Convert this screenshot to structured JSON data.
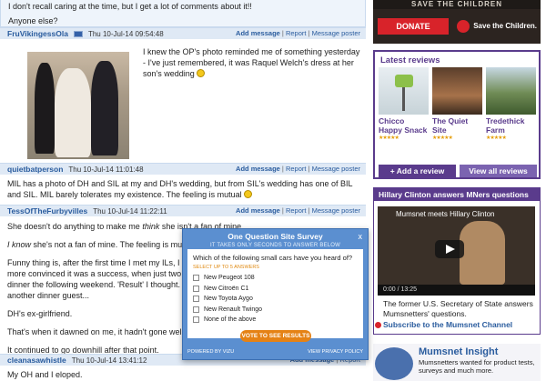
{
  "thread": {
    "top_post": {
      "line1": "I don't recall caring at the time, but I get a lot of comments about it!!",
      "line2": "Anyone else?"
    },
    "posts": [
      {
        "poster": "FruVikingessOla",
        "timestamp": "Thu 10-Jul-14 09:54:48",
        "text": "I knew the OP's photo reminded me of something yesterday - I've just remembered, it was Raquel Welch's dress at her son's wedding"
      },
      {
        "poster": "quietbatperson",
        "timestamp": "Thu 10-Jul-14 11:01:48",
        "text": "MIL has a photo of DH and SIL at my and DH's wedding, but from SIL's wedding has one of BIL and SIL. MIL barely tolerates my existence. The feeling is mutual"
      },
      {
        "poster": "TessOfTheFurbyvilles",
        "timestamp": "Thu 10-Jul-14 11:22:11",
        "p1_before": "She doesn't do anything to make me ",
        "p1_italic": "think",
        "p1_after": " she isn't a fan of mine.",
        "p2_italic": "I know",
        "p2_after": " she's not a fan of mine. The feeling is mu",
        "p3a": "Funny thing is, after the first time I met my ILs, I",
        "p3b": "more convinced it was a success, when just two",
        "p3c": "dinner the following weekend. 'Result' I thought.",
        "p3d": "another dinner guest...",
        "p4": "DH's ex-girlfriend.",
        "p5": "That's when it dawned on me, it hadn't gone well",
        "p6": "It continued to go downhill after that point."
      },
      {
        "poster": "cleanasawhistle",
        "timestamp": "Thu 10-Jul-14 13:41:12",
        "text": "My OH and I eloped."
      }
    ],
    "actions": {
      "add": "Add message",
      "report": "Report",
      "message": "Message poster",
      "sep": "|"
    }
  },
  "sidebar": {
    "ad": {
      "top_text": "SAVE THE CHILDREN",
      "donate": "DONATE",
      "brand": "Save the Children."
    },
    "reviews": {
      "title": "Latest reviews",
      "items": [
        {
          "title": "Chicco Happy Snack",
          "stars": "★★★★★"
        },
        {
          "title": "The Quiet Site",
          "stars": "★★★★★"
        },
        {
          "title": "Tredethick Farm",
          "stars": "★★★★★"
        }
      ],
      "add_button": "+ Add a review",
      "all_button": "View all reviews"
    },
    "video": {
      "header": "Hillary Clinton answers MNers questions",
      "video_title": "Mumsnet meets Hillary Clinton",
      "time": "0:00 / 13:25",
      "caption": "The former U.S. Secretary of State answers Mumsnetters' questions.",
      "subscribe": "Subscribe to the Mumsnet Channel"
    },
    "insight": {
      "title": "Mumsnet Insight",
      "text": "Mumsnetters wanted for product tests, surveys and much more."
    }
  },
  "survey": {
    "title": "One Question Site Survey",
    "subtitle": "IT TAKES ONLY SECONDS TO ANSWER BELOW",
    "close": "x",
    "question": "Which of the following small cars have you heard of?",
    "hint": "SELECT UP TO 5 ANSWERS",
    "options": [
      "New Peugeot 108",
      "New Citroën C1",
      "New Toyota Aygo",
      "New Renault Twingo",
      "None of the above"
    ],
    "vote": "VOTE TO SEE RESULTS",
    "powered": "POWERED BY VIZU",
    "privacy": "VIEW PRIVACY POLICY"
  },
  "colors": {
    "accent_purple": "#5a3b8c",
    "link_blue": "#2a5c9e",
    "donate_red": "#d8232a",
    "survey_blue": "#5b8fd0"
  }
}
